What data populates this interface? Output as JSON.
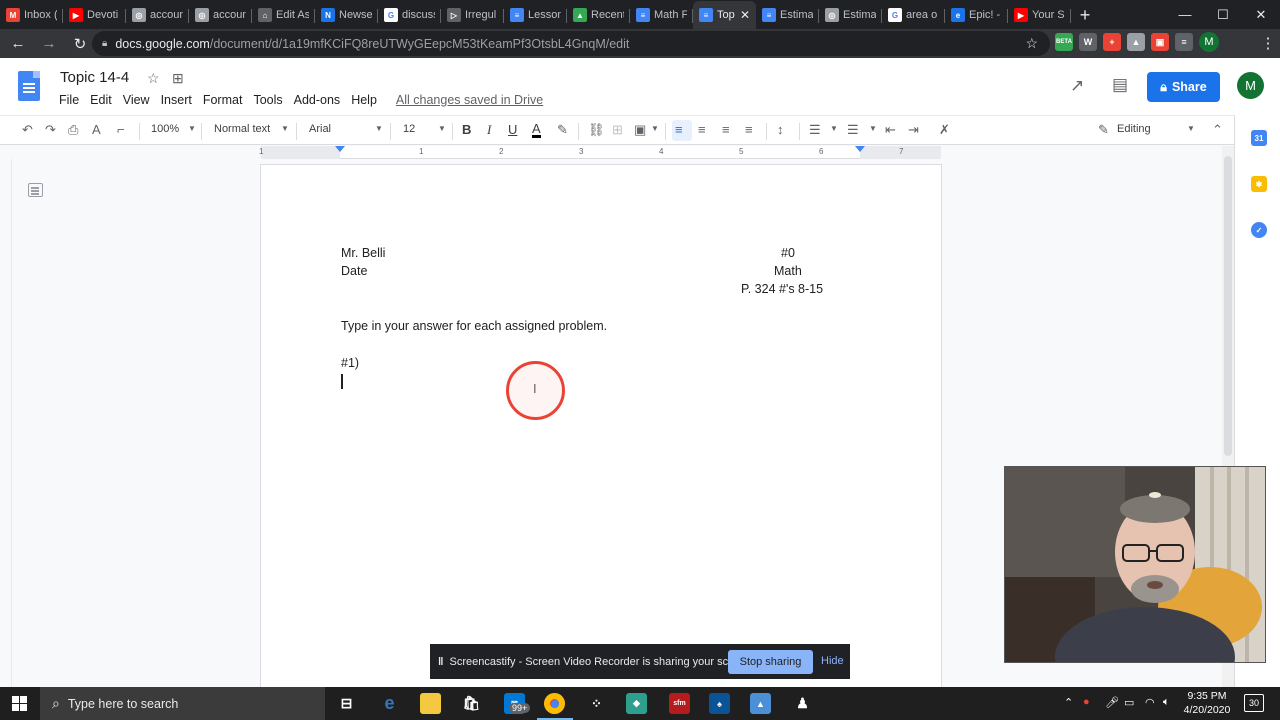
{
  "browser": {
    "tabs": [
      {
        "label": "Inbox (",
        "icon": "gmail-icon",
        "color": "#ea4335",
        "glyph": "M"
      },
      {
        "label": "Devoti",
        "icon": "youtube-icon",
        "color": "#ff0000",
        "glyph": "▶"
      },
      {
        "label": "accoun",
        "icon": "globe-icon",
        "color": "#9aa0a6",
        "glyph": "◎"
      },
      {
        "label": "accoun",
        "icon": "globe-icon",
        "color": "#9aa0a6",
        "glyph": "◎"
      },
      {
        "label": "Edit As",
        "icon": "edpuzzle-icon",
        "color": "#5f6368",
        "glyph": "⌂"
      },
      {
        "label": "Newse",
        "icon": "newsela-icon",
        "color": "#1a73e8",
        "glyph": "N"
      },
      {
        "label": "discuss",
        "icon": "google-icon",
        "color": "#ffffff",
        "glyph": "G"
      },
      {
        "label": "Irregul",
        "icon": "play-outline-icon",
        "color": "#5f6368",
        "glyph": "▷"
      },
      {
        "label": "Lesson",
        "icon": "docs-icon",
        "color": "#4285f4",
        "glyph": "≡"
      },
      {
        "label": "Recent",
        "icon": "drive-icon",
        "color": "#34a853",
        "glyph": "▲"
      },
      {
        "label": "Math F",
        "icon": "docs-icon",
        "color": "#4285f4",
        "glyph": "≡"
      },
      {
        "label": "Top",
        "icon": "docs-icon",
        "color": "#4285f4",
        "glyph": "≡",
        "active": true
      },
      {
        "label": "Estima",
        "icon": "docs-icon",
        "color": "#4285f4",
        "glyph": "≡"
      },
      {
        "label": "Estima",
        "icon": "globe-icon",
        "color": "#9aa0a6",
        "glyph": "◎"
      },
      {
        "label": "area o",
        "icon": "google-icon",
        "color": "#ffffff",
        "glyph": "G"
      },
      {
        "label": "Epic! -",
        "icon": "epic-icon",
        "color": "#1a73e8",
        "glyph": "e"
      },
      {
        "label": "Your S",
        "icon": "youtube-studio-icon",
        "color": "#ff0000",
        "glyph": "▶"
      }
    ],
    "url_host": "docs.google.com",
    "url_path": "/document/d/1a19mfKCiFQ8reUTWyGEepcM53tKeamPf3OtsbL4GnqM/edit",
    "extensions": [
      {
        "name": "beta-extension-icon",
        "label": "BETA",
        "color": "#34a853"
      },
      {
        "name": "w-extension-icon",
        "label": "W",
        "color": "#5f6368"
      },
      {
        "name": "red-extension-icon",
        "label": "+",
        "color": "#ea4335"
      },
      {
        "name": "drive-extension-icon",
        "label": "▲",
        "color": "#9aa0a6"
      },
      {
        "name": "screencastify-extension-icon",
        "label": "▣",
        "color": "#ea4335"
      },
      {
        "name": "playlist-extension-icon",
        "label": "≡",
        "color": "#5f6368"
      }
    ],
    "profile_initial": "M"
  },
  "doc": {
    "title": "Topic 14-4",
    "menus": [
      "File",
      "Edit",
      "View",
      "Insert",
      "Format",
      "Tools",
      "Add-ons",
      "Help"
    ],
    "save_status": "All changes saved in Drive",
    "share_label": "Share",
    "user_initial": "M"
  },
  "toolbar": {
    "zoom": "100%",
    "style": "Normal text",
    "font": "Arial",
    "size": "12",
    "mode": "Editing"
  },
  "ruler": {
    "labels": [
      "1",
      "1",
      "2",
      "3",
      "4",
      "5",
      "6",
      "7"
    ]
  },
  "content": {
    "teacher": "Mr. Belli",
    "date": "Date",
    "number": "#0",
    "subject": "Math",
    "assignment": "P. 324 #'s 8-15",
    "instructions": "Type in your answer for each assigned problem.",
    "problem_label": "#1)"
  },
  "screencastify": {
    "message": "Screencastify - Screen Video Recorder is sharing your screen.",
    "stop_label": "Stop sharing",
    "hide_label": "Hide"
  },
  "taskbar": {
    "search_placeholder": "Type here to search",
    "mail_badge": "99+",
    "time": "9:35 PM",
    "date": "4/20/2020",
    "notifications": "30"
  }
}
